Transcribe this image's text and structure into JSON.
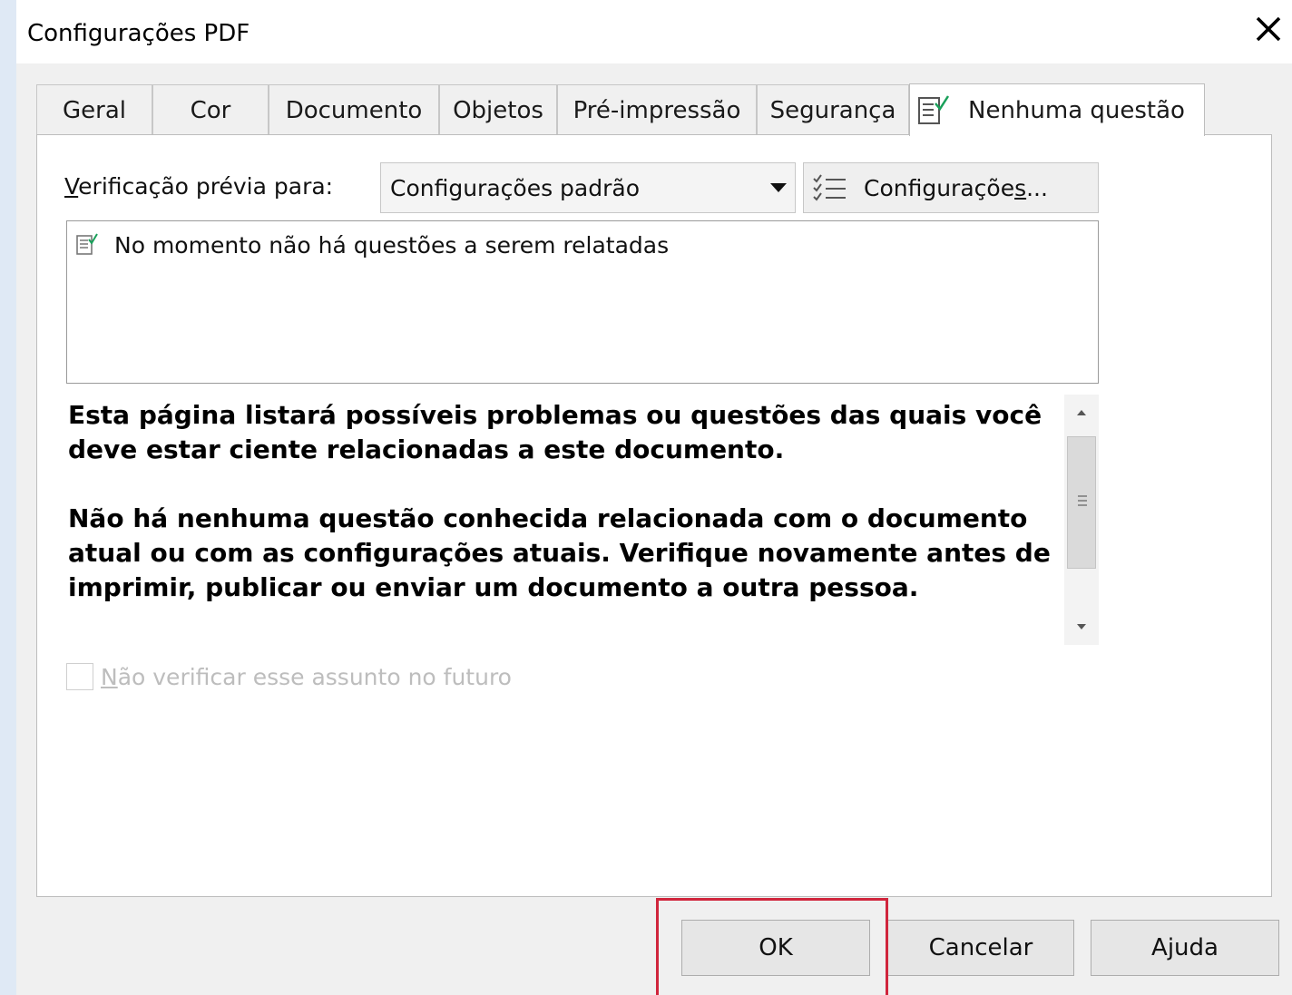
{
  "window": {
    "title": "Configurações PDF",
    "close_icon": "close-icon"
  },
  "tabs": [
    {
      "label": "Geral"
    },
    {
      "label": "Cor"
    },
    {
      "label": "Documento"
    },
    {
      "label": "Objetos"
    },
    {
      "label": "Pré-impressão"
    },
    {
      "label": "Segurança"
    },
    {
      "label": "Nenhuma questão",
      "icon": "checklist-icon",
      "active": true
    }
  ],
  "preflight": {
    "label_prefix": "V",
    "label_rest": "erificação prévia para:",
    "combo_value": "Configurações padrão",
    "settings_label_a": "Configuraçõe",
    "settings_label_u": "s",
    "settings_label_b": "..."
  },
  "issues": [
    {
      "text": "No momento não há questões a serem relatadas",
      "icon": "checklist-icon"
    }
  ],
  "description": {
    "p1": "Esta página listará possíveis problemas ou questões das quais você deve estar ciente relacionadas a este documento.",
    "p2": "Não há nenhuma questão conhecida relacionada com o documento atual ou com as configurações atuais. Verifique novamente antes de imprimir, publicar ou enviar um documento a outra pessoa."
  },
  "checkbox": {
    "label_u": "N",
    "label_rest": "ão verificar esse assunto no futuro",
    "checked": false,
    "enabled": false
  },
  "buttons": {
    "ok": "OK",
    "cancel": "Cancelar",
    "help": "Ajuda"
  },
  "colors": {
    "highlight": "#d0253c",
    "check_green": "#19a05a"
  }
}
